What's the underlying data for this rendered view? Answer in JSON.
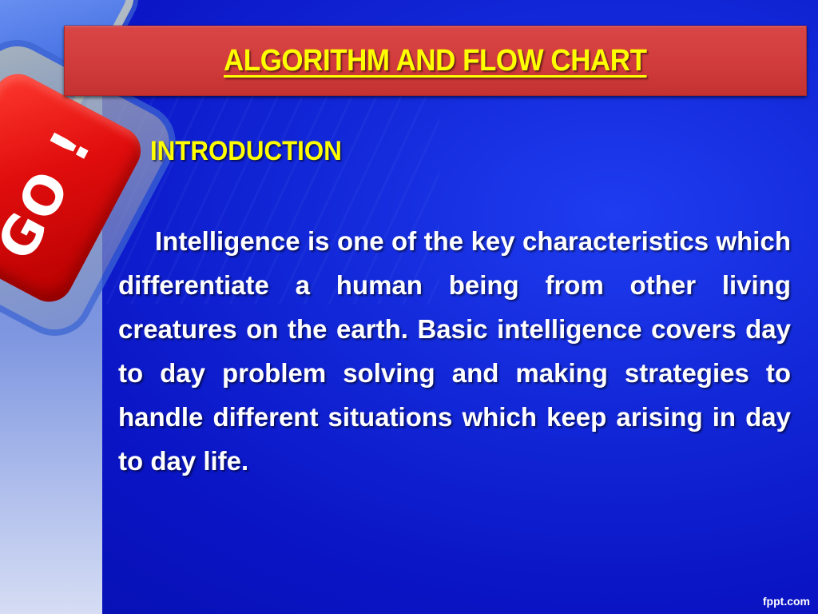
{
  "slide": {
    "title": "ALGORITHM AND FLOW CHART",
    "section_heading": "INTRODUCTION",
    "body": "Intelligence is one of the key characteristics which differentiate a human being from other  living creatures on the earth. Basic intelligence covers day to day problem solving and  making strategies to handle different situations which keep arising in day to day life.",
    "decoration_key_label": "GO !",
    "watermark": "fppt.com"
  },
  "colors": {
    "background": "#0a14c8",
    "title_bar": "#d23c3c",
    "title_text": "#ffff00",
    "heading_text": "#ffff00",
    "body_text": "#ffffff",
    "key_red": "#e00d0d"
  }
}
